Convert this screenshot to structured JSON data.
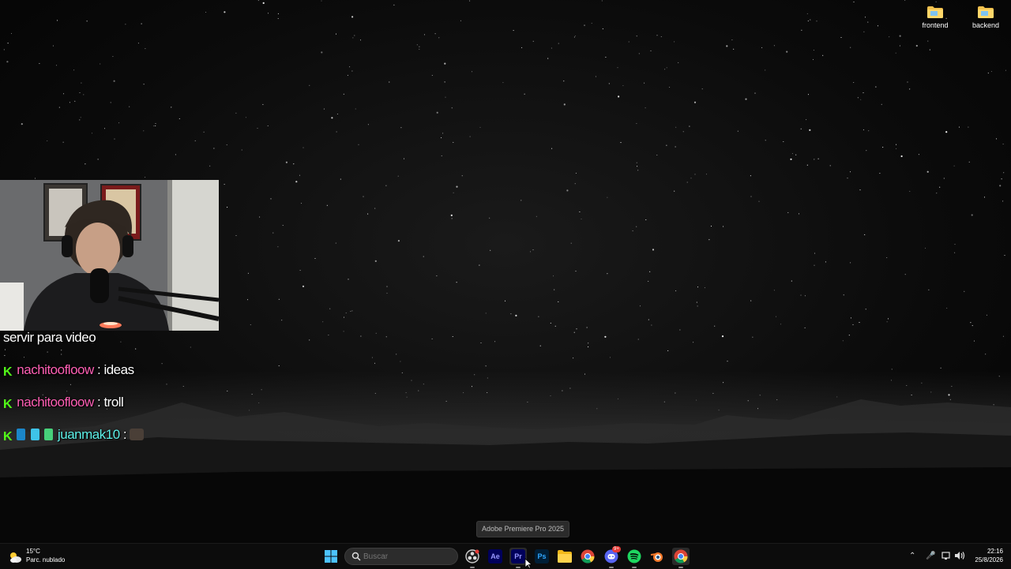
{
  "desktop": {
    "icons": [
      {
        "label": "frontend",
        "icon": "folder-icon"
      },
      {
        "label": "backend",
        "icon": "folder-icon"
      }
    ]
  },
  "stream_overlay": {
    "chat": [
      {
        "text_before": "servir para video"
      },
      {
        "user": "nachitooflow_display",
        "user_text": "nachitoofloow",
        "sep": " : ",
        "message": "ideas"
      },
      {
        "user_text": "nachitoofloow",
        "sep": " : ",
        "message": "troll"
      },
      {
        "user_text": "juanmak10",
        "sep": " : ",
        "message": ""
      }
    ],
    "chat_colors": {
      "pink": "#ff5fb4",
      "cyan": "#5df0e8",
      "kick_green": "#53fc18"
    }
  },
  "tooltip": {
    "text": "Adobe Premiere Pro 2025"
  },
  "taskbar": {
    "weather": {
      "temp": "15°C",
      "condition": "Parc. nublado",
      "icon": "partly-cloudy-icon"
    },
    "search": {
      "placeholder": "Buscar"
    },
    "apps": [
      "start-icon",
      "obs-icon",
      "after-effects-icon",
      "premiere-pro-icon",
      "photoshop-icon",
      "file-explorer-icon",
      "chrome-icon",
      "discord-icon",
      "spotify-icon",
      "blender-icon",
      "chrome-dev-icon"
    ],
    "app_labels": {
      "ae": "Ae",
      "pr": "Pr",
      "ps": "Ps",
      "discord_badge": "9+"
    },
    "clock": {
      "time": "22:16",
      "date": "25/8/2026"
    },
    "tray": [
      "chevron-up-icon",
      "microphone-icon",
      "network-icon",
      "volume-icon"
    ]
  }
}
